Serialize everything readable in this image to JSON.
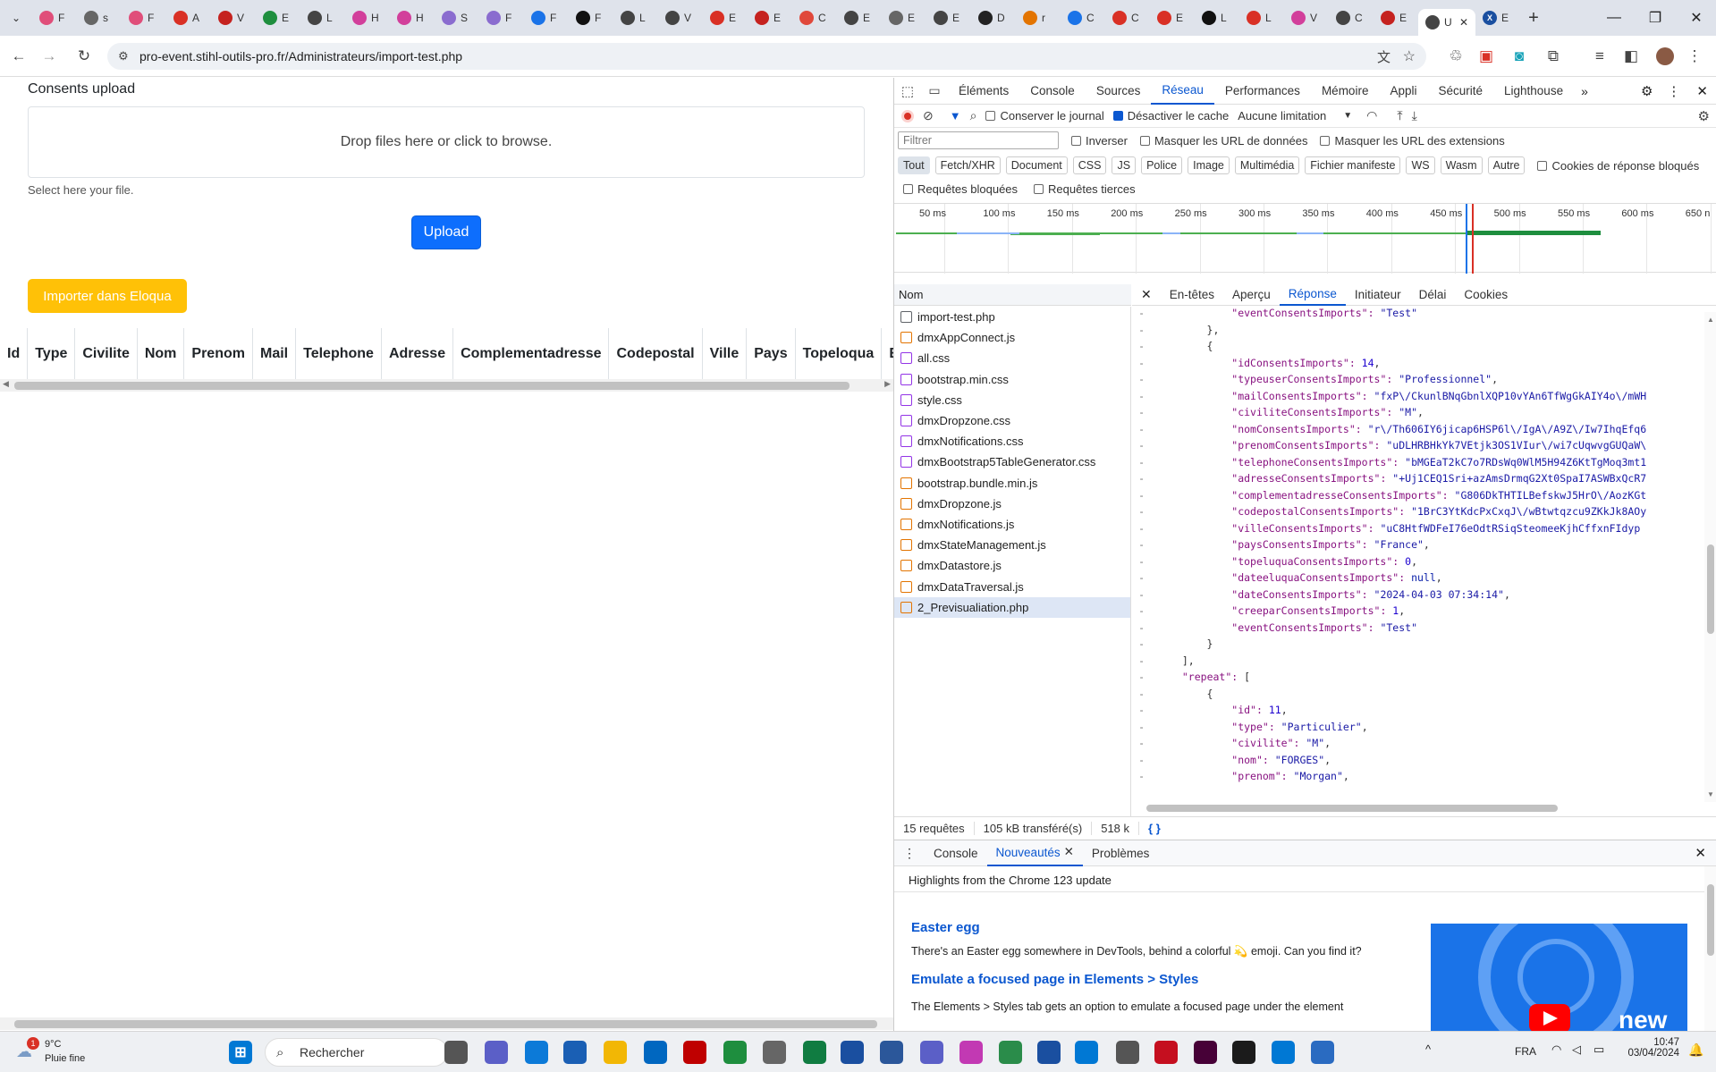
{
  "browser": {
    "url": "pro-event.stihl-outils-pro.fr/Administrateurs/import-test.php",
    "active_tab_label": "U",
    "tabs": [
      {
        "label": "F",
        "color": "#e04e7a"
      },
      {
        "label": "s",
        "color": "#666"
      },
      {
        "label": "F",
        "color": "#e04e7a"
      },
      {
        "label": "A",
        "color": "#d93025"
      },
      {
        "label": "V",
        "color": "#c5221f"
      },
      {
        "label": "E",
        "color": "#1e8e3e"
      },
      {
        "label": "L",
        "color": "#444"
      },
      {
        "label": "H",
        "color": "#d23f9b"
      },
      {
        "label": "H",
        "color": "#d23f9b"
      },
      {
        "label": "S",
        "color": "#8a6ccf"
      },
      {
        "label": "F",
        "color": "#8a6ccf"
      },
      {
        "label": "F",
        "color": "#1a73e8"
      },
      {
        "label": "F",
        "color": "#111"
      },
      {
        "label": "L",
        "color": "#444"
      },
      {
        "label": "V",
        "color": "#444"
      },
      {
        "label": "E",
        "color": "#d93025"
      },
      {
        "label": "E",
        "color": "#c5221f"
      },
      {
        "label": "C",
        "color": "#e0483b"
      },
      {
        "label": "E",
        "color": "#444"
      },
      {
        "label": "E",
        "color": "#666"
      },
      {
        "label": "E",
        "color": "#444"
      },
      {
        "label": "D",
        "color": "#222"
      },
      {
        "label": "r",
        "color": "#e37400"
      },
      {
        "label": "C",
        "color": "#1a73e8"
      },
      {
        "label": "C",
        "color": "#d93025"
      },
      {
        "label": "E",
        "color": "#d93025"
      },
      {
        "label": "L",
        "color": "#111"
      },
      {
        "label": "L",
        "color": "#d93025"
      },
      {
        "label": "V",
        "color": "#d23f9b"
      },
      {
        "label": "C",
        "color": "#444"
      },
      {
        "label": "E",
        "color": "#c5221f"
      }
    ],
    "last_tab_label": "E"
  },
  "page": {
    "consents_title": "Consents upload",
    "dropzone_text": "Drop files here or click to browse.",
    "help_text": "Select here your file.",
    "upload_label": "Upload",
    "eloqua_label": "Importer dans Eloqua",
    "table_headers": [
      "Id",
      "Type",
      "Civilite",
      "Nom",
      "Prenom",
      "Mail",
      "Telephone",
      "Adresse",
      "Complementadresse",
      "Codepostal",
      "Ville",
      "Pays",
      "Topeloqua",
      "Ev"
    ]
  },
  "devtools": {
    "tabs": [
      "Éléments",
      "Console",
      "Sources",
      "Réseau",
      "Performances",
      "Mémoire",
      "Appli",
      "Sécurité",
      "Lighthouse"
    ],
    "active_tab": "Réseau",
    "toolbar": {
      "preserve_log": "Conserver le journal",
      "disable_cache": "Désactiver le cache",
      "throttling": "Aucune limitation"
    },
    "filter": {
      "placeholder": "Filtrer",
      "invert": "Inverser",
      "hide_data_urls": "Masquer les URL de données",
      "hide_ext_urls": "Masquer les URL des extensions"
    },
    "types": [
      "Tout",
      "Fetch/XHR",
      "Document",
      "CSS",
      "JS",
      "Police",
      "Image",
      "Multimédia",
      "Fichier manifeste",
      "WS",
      "Wasm",
      "Autre"
    ],
    "blocked_cookies": "Cookies de réponse bloqués",
    "blocked_requests": "Requêtes bloquées",
    "third_party": "Requêtes tierces",
    "timeline_ticks": [
      "50 ms",
      "100 ms",
      "150 ms",
      "200 ms",
      "250 ms",
      "300 ms",
      "350 ms",
      "400 ms",
      "450 ms",
      "500 ms",
      "550 ms",
      "600 ms",
      "650 n"
    ],
    "name_header": "Nom",
    "requests": [
      {
        "name": "import-test.php",
        "kind": "doc"
      },
      {
        "name": "dmxAppConnect.js",
        "kind": "js"
      },
      {
        "name": "all.css",
        "kind": "css"
      },
      {
        "name": "bootstrap.min.css",
        "kind": "css"
      },
      {
        "name": "style.css",
        "kind": "css"
      },
      {
        "name": "dmxDropzone.css",
        "kind": "css"
      },
      {
        "name": "dmxNotifications.css",
        "kind": "css"
      },
      {
        "name": "dmxBootstrap5TableGenerator.css",
        "kind": "css"
      },
      {
        "name": "bootstrap.bundle.min.js",
        "kind": "js"
      },
      {
        "name": "dmxDropzone.js",
        "kind": "js"
      },
      {
        "name": "dmxNotifications.js",
        "kind": "js"
      },
      {
        "name": "dmxStateManagement.js",
        "kind": "js"
      },
      {
        "name": "dmxDatastore.js",
        "kind": "js"
      },
      {
        "name": "dmxDataTraversal.js",
        "kind": "js"
      },
      {
        "name": "2_Previsualiation.php",
        "kind": "xhr"
      }
    ],
    "detail_tabs": [
      "En-têtes",
      "Aperçu",
      "Réponse",
      "Initiateur",
      "Délai",
      "Cookies"
    ],
    "active_detail_tab": "Réponse",
    "code_lines": [
      {
        "indent": 3,
        "k": "eventConsentsImports",
        "v": "\"Test\"",
        "t": "str",
        "end": ""
      },
      {
        "indent": 2,
        "raw": "},"
      },
      {
        "indent": 2,
        "raw": "{"
      },
      {
        "indent": 3,
        "k": "idConsentsImports",
        "v": "14",
        "t": "num",
        "end": ","
      },
      {
        "indent": 3,
        "k": "typeuserConsentsImports",
        "v": "\"Professionnel\"",
        "t": "str",
        "end": ","
      },
      {
        "indent": 3,
        "k": "mailConsentsImports",
        "v": "\"fxP\\/CkunlBNqGbnlXQP10vYAn6TfWgGkAIY4o\\/mWH",
        "t": "str",
        "end": ""
      },
      {
        "indent": 3,
        "k": "civiliteConsentsImports",
        "v": "\"M\"",
        "t": "str",
        "end": ","
      },
      {
        "indent": 3,
        "k": "nomConsentsImports",
        "v": "\"r\\/Th606IY6jicap6HSP6l\\/IgA\\/A9Z\\/Iw7IhqEfq6",
        "t": "str",
        "end": ""
      },
      {
        "indent": 3,
        "k": "prenomConsentsImports",
        "v": "\"uDLHRBHkYk7VEtjk3OS1VIur\\/wi7cUqwvgGUQaW\\",
        "t": "str",
        "end": ""
      },
      {
        "indent": 3,
        "k": "telephoneConsentsImports",
        "v": "\"bMGEaT2kC7o7RDsWq0WlM5H94Z6KtTgMoq3mt1",
        "t": "str",
        "end": ""
      },
      {
        "indent": 3,
        "k": "adresseConsentsImports",
        "v": "\"+Uj1CEQ1Sri+azAmsDrmqG2Xt0SpaI7ASWBxQcR7",
        "t": "str",
        "end": ""
      },
      {
        "indent": 3,
        "k": "complementadresseConsentsImports",
        "v": "\"G806DkTHTILBefskwJ5HrO\\/AozKGt",
        "t": "str",
        "end": ""
      },
      {
        "indent": 3,
        "k": "codepostalConsentsImports",
        "v": "\"1BrC3YtKdcPxCxqJ\\/wBtwtqzcu9ZKkJk8AOy",
        "t": "str",
        "end": ""
      },
      {
        "indent": 3,
        "k": "villeConsentsImports",
        "v": "\"uC8HtfWDFeI76eOdtRSiqSteomeeKjhCffxnFIdyp",
        "t": "str",
        "end": ""
      },
      {
        "indent": 3,
        "k": "paysConsentsImports",
        "v": "\"France\"",
        "t": "str",
        "end": ","
      },
      {
        "indent": 3,
        "k": "topeluquaConsentsImports",
        "v": "0",
        "t": "num",
        "end": ","
      },
      {
        "indent": 3,
        "k": "dateeluquaConsentsImports",
        "v": "null",
        "t": "kw",
        "end": ","
      },
      {
        "indent": 3,
        "k": "dateConsentsImports",
        "v": "\"2024-04-03 07:34:14\"",
        "t": "str",
        "end": ","
      },
      {
        "indent": 3,
        "k": "creeparConsentsImports",
        "v": "1",
        "t": "num",
        "end": ","
      },
      {
        "indent": 3,
        "k": "eventConsentsImports",
        "v": "\"Test\"",
        "t": "str",
        "end": ""
      },
      {
        "indent": 2,
        "raw": "}"
      },
      {
        "indent": 1,
        "raw": "],"
      },
      {
        "indent": 1,
        "k": "repeat",
        "v": "[",
        "t": "pun",
        "end": ""
      },
      {
        "indent": 2,
        "raw": "{"
      },
      {
        "indent": 3,
        "k": "id",
        "v": "11",
        "t": "num",
        "end": ","
      },
      {
        "indent": 3,
        "k": "type",
        "v": "\"Particulier\"",
        "t": "str",
        "end": ","
      },
      {
        "indent": 3,
        "k": "civilite",
        "v": "\"M\"",
        "t": "str",
        "end": ","
      },
      {
        "indent": 3,
        "k": "nom",
        "v": "\"FORGES\"",
        "t": "str",
        "end": ","
      },
      {
        "indent": 3,
        "k": "prenom",
        "v": "\"Morgan\"",
        "t": "str",
        "end": ","
      }
    ],
    "status": {
      "requests": "15 requêtes",
      "transferred": "105 kB transféré(s)",
      "resources": "518 k"
    },
    "drawer_tabs": [
      "Console",
      "Nouveautés",
      "Problèmes"
    ],
    "active_drawer_tab": "Nouveautés",
    "whatsnew": {
      "header": "Highlights from the Chrome 123 update",
      "h1": "Easter egg",
      "p1": "There's an Easter egg somewhere in DevTools, behind a colorful 💫 emoji. Can you find it?",
      "h2": "Emulate a focused page in Elements > Styles",
      "p2": "The Elements > Styles tab gets an option to emulate a focused page under the element",
      "img_label": "new"
    }
  },
  "taskbar": {
    "weather_temp": "9°C",
    "weather_desc": "Pluie fine",
    "weather_badge": "1",
    "search_placeholder": "Rechercher",
    "lang": "FRA",
    "time": "10:47",
    "date": "03/04/2024"
  }
}
